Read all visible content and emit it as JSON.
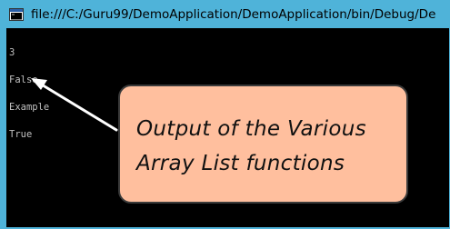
{
  "window": {
    "title": "file:///C:/Guru99/DemoApplication/DemoApplication/bin/Debug/De",
    "icon": "console-app-icon",
    "frame_color": "#4fb3d9"
  },
  "console": {
    "lines": [
      "3",
      "False",
      "Example",
      "True"
    ],
    "text_color": "#c0c0c0",
    "background": "#000000"
  },
  "annotation": {
    "lines": [
      "Output of the Various",
      "Array List functions"
    ],
    "background": "#ffbf9e",
    "arrow_color": "#ffffff"
  }
}
